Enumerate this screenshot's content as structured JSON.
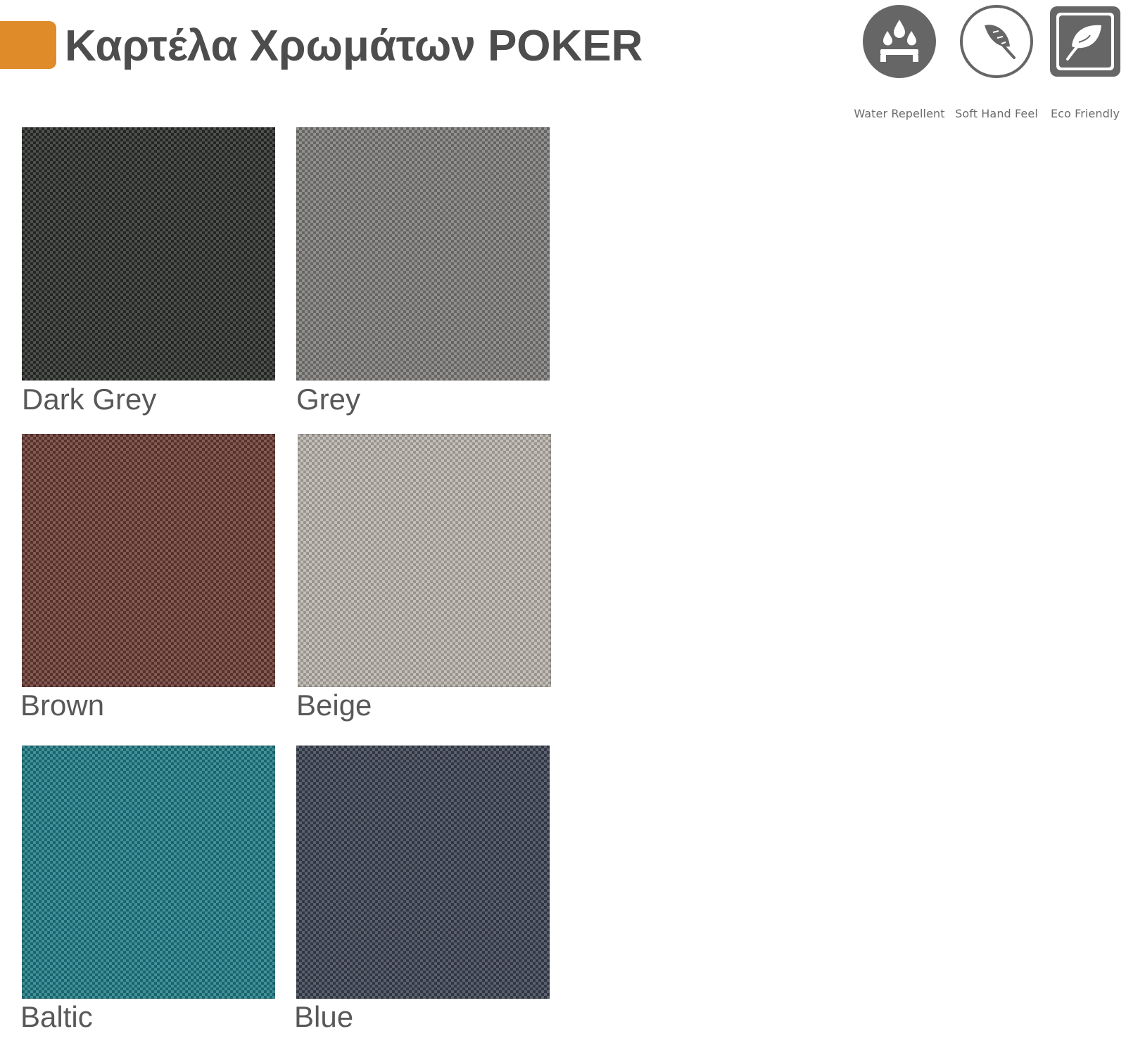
{
  "header": {
    "title": "Καρτέλα Χρωμάτων POKER",
    "accent_color": "#E08B2A"
  },
  "features": [
    {
      "label": "Water Repellent",
      "icon": "water-drops-icon"
    },
    {
      "label": "Soft Hand Feel",
      "icon": "feather-icon"
    },
    {
      "label": "Eco Friendly",
      "icon": "leaf-icon"
    }
  ],
  "swatches": [
    {
      "name": "Dark Grey",
      "color": "#2c2e2c"
    },
    {
      "name": "Grey",
      "color": "#7d7b79"
    },
    {
      "name": "Brown",
      "color": "#6b3b35"
    },
    {
      "name": "Beige",
      "color": "#b9b4ac"
    },
    {
      "name": "Baltic",
      "color": "#1f7b85"
    },
    {
      "name": "Blue",
      "color": "#3c4252"
    }
  ]
}
